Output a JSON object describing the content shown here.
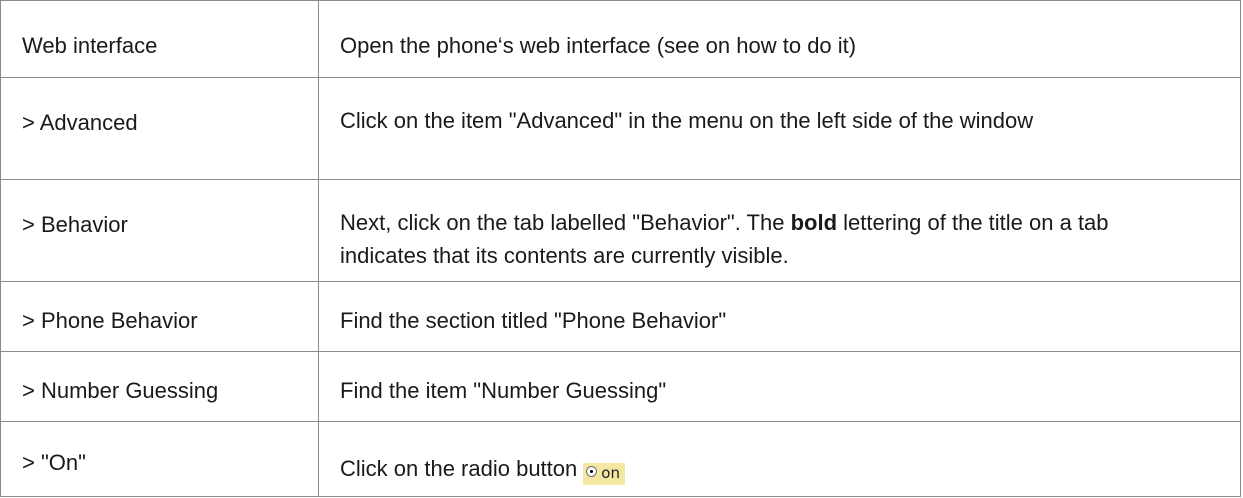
{
  "rows": [
    {
      "step": "Web interface",
      "description": "Open the phone‘s web interface (see on how to do it)"
    },
    {
      "step": "> Advanced",
      "description": "Click on the item \"Advanced\" in the menu on the left side of the window"
    },
    {
      "step": "> Behavior",
      "description_before": "Next, click on the tab labelled \"Behavior\".  The ",
      "description_bold": "bold",
      "description_after": " lettering of the title on a tab indicates that its contents are currently visible."
    },
    {
      "step": "> Phone Behavior",
      "description": "Find the section titled \"Phone Behavior\""
    },
    {
      "step": "> Number Guessing",
      "description": "Find the item \"Number Guessing\""
    },
    {
      "step": "> \"On\"",
      "description": "Click on the radio button",
      "radio_label": "on",
      "radio_bg_color": "#f3e7a2"
    }
  ]
}
